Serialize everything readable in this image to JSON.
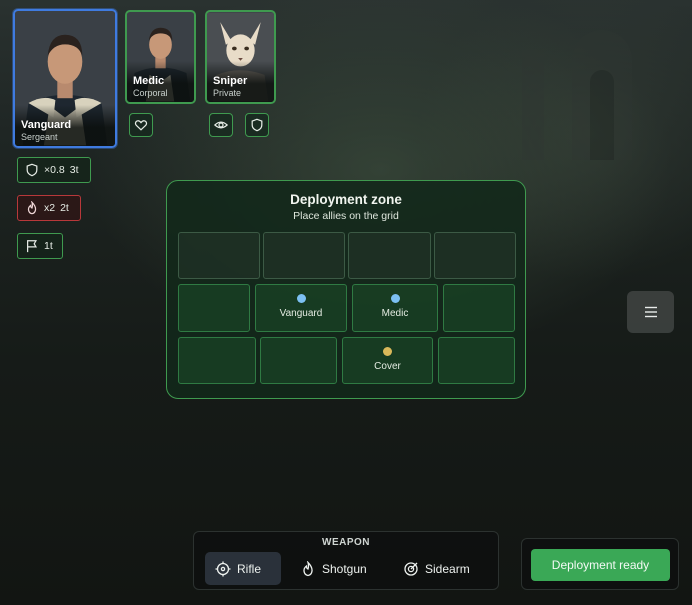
{
  "party": [
    {
      "name": "Vanguard",
      "rank": "Sergeant",
      "selected": true
    },
    {
      "name": "Medic",
      "rank": "Corporal",
      "selected": false
    },
    {
      "name": "Sniper",
      "rank": "Private",
      "selected": false
    }
  ],
  "abilities": {
    "medic": {
      "icon": "heart-icon"
    },
    "sniper": [
      {
        "icon": "eye-icon"
      },
      {
        "icon": "shield-icon"
      }
    ]
  },
  "statuses": [
    {
      "icon": "shield-icon",
      "value": "×0.8",
      "duration": "3t",
      "color": "#3f9a4f"
    },
    {
      "icon": "flame-icon",
      "value": "x2",
      "duration": "2t",
      "color": "#b8383a"
    },
    {
      "icon": "flag-icon",
      "value": "",
      "duration": "1t",
      "color": "#3f9a4f"
    }
  ],
  "deployment": {
    "title": "Deployment zone",
    "subtitle": "Place allies on the grid",
    "rows": [
      [
        {
          "label": ""
        },
        {
          "label": ""
        },
        {
          "label": ""
        },
        {
          "label": ""
        }
      ],
      [
        {
          "label": ""
        },
        {
          "label": "Vanguard",
          "dot": "#7cc0f2"
        },
        {
          "label": "Medic",
          "dot": "#7cc0f2"
        },
        {
          "label": ""
        }
      ],
      [
        {
          "label": ""
        },
        {
          "label": ""
        },
        {
          "label": "Cover",
          "dot": "#d9b85a"
        },
        {
          "label": ""
        }
      ]
    ]
  },
  "weapon": {
    "title": "WEAPON",
    "options": [
      {
        "label": "Rifle",
        "icon": "crosshair-icon",
        "selected": true
      },
      {
        "label": "Shotgun",
        "icon": "flame-icon",
        "selected": false
      },
      {
        "label": "Sidearm",
        "icon": "target-icon",
        "selected": false
      }
    ]
  },
  "ready_button": "Deployment ready",
  "colors": {
    "accent": "#3f9a4f",
    "selected": "#3f7be0",
    "ready": "#3aa856",
    "danger": "#b8383a"
  }
}
